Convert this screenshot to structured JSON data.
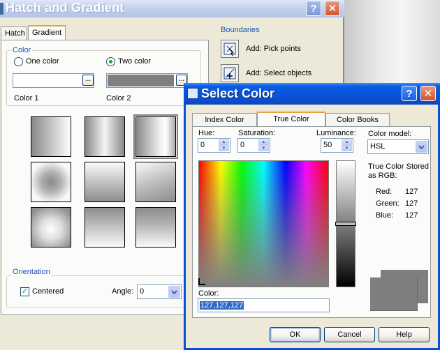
{
  "hatch_dialog": {
    "title": "Hatch and Gradient",
    "tabs": [
      {
        "label": "Hatch"
      },
      {
        "label": "Gradient",
        "active": true
      }
    ],
    "color_group": {
      "label": "Color",
      "one_color": {
        "label": "One color",
        "selected": false
      },
      "two_color": {
        "label": "Two color",
        "selected": true
      },
      "color1_label": "Color 1",
      "color2_label": "Color 2",
      "ellipsis": "..."
    },
    "boundaries": {
      "label": "Boundaries",
      "add_pick_points": "Add: Pick points",
      "add_select_objects": "Add: Select objects"
    },
    "orientation": {
      "label": "Orientation",
      "centered_label": "Centered",
      "centered_checked": true,
      "check_mark": "✓",
      "angle_label": "Angle:",
      "angle_value": "0"
    }
  },
  "select_color_dialog": {
    "title": "Select Color",
    "tabs": [
      {
        "label": "Index Color"
      },
      {
        "label": "True Color",
        "active": true
      },
      {
        "label": "Color Books"
      }
    ],
    "hue": {
      "label": "Hue:",
      "value": "0"
    },
    "saturation": {
      "label": "Saturation:",
      "value": "0"
    },
    "luminance": {
      "label": "Luminance:",
      "value": "50"
    },
    "color_model": {
      "label": "Color model:",
      "value": "HSL"
    },
    "rgb_info": {
      "stored_label": "True Color Stored as RGB:",
      "red_label": "Red:",
      "red": "127",
      "green_label": "Green:",
      "green": "127",
      "blue_label": "Blue:",
      "blue": "127"
    },
    "color_field": {
      "label": "Color:",
      "value": "127,127,127"
    },
    "buttons": {
      "ok": "OK",
      "cancel": "Cancel",
      "help": "Help"
    },
    "preview_color": "#7f7f7f"
  },
  "titlebar_buttons": {
    "help": "?",
    "close": "✕"
  },
  "icons": {
    "help": "question-mark-icon",
    "close": "close-x-icon",
    "chevron": "chevron-down-icon"
  },
  "colors": {
    "xp_blue_title": "#0853d8",
    "group_label_blue": "#1c52ba",
    "check_green": "#21a121",
    "gray_127": "#7f7f7f"
  }
}
